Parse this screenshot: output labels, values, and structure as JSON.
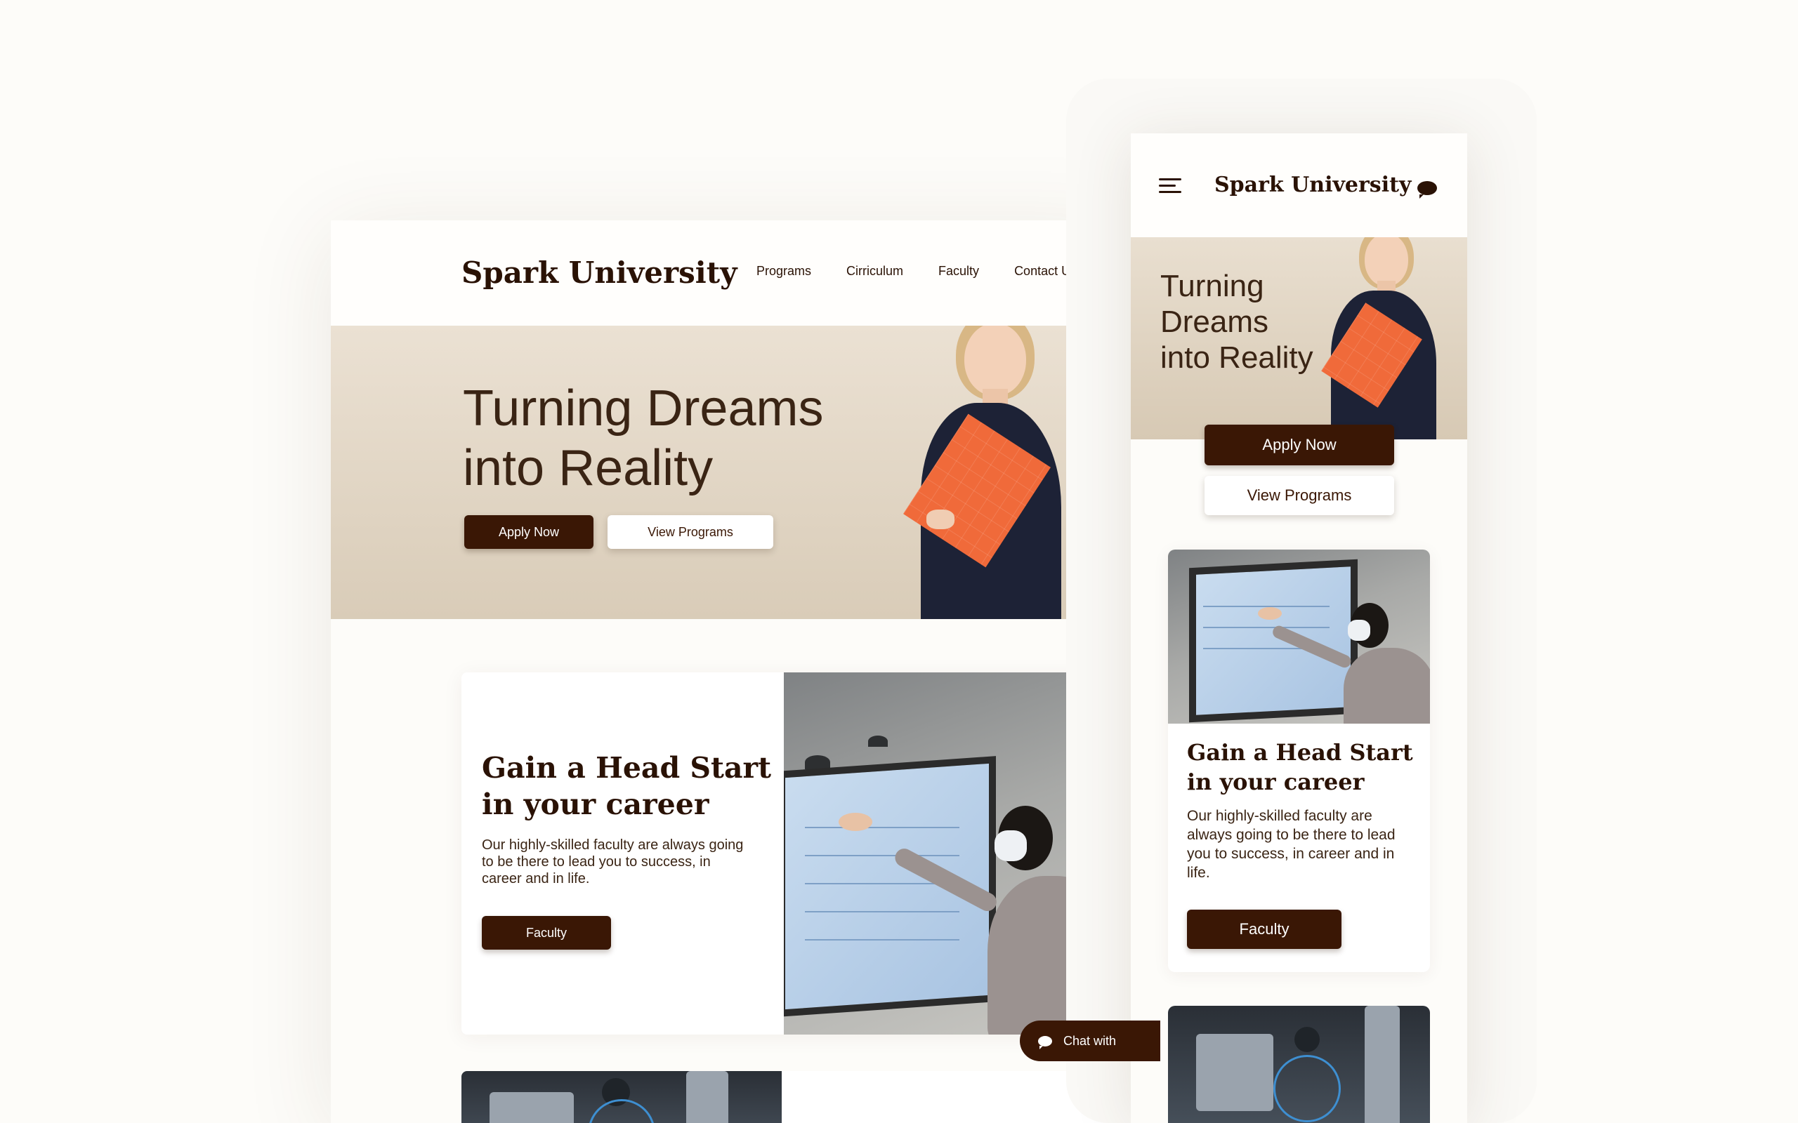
{
  "desktop": {
    "logo": "Spark University",
    "nav": [
      "Programs",
      "Cirriculum",
      "Faculty",
      "Contact Us"
    ],
    "hero": {
      "title_line1": "Turning Dreams",
      "title_line2": "into Reality",
      "apply_label": "Apply Now",
      "view_label": "View Programs"
    },
    "feature_card": {
      "title_line1": "Gain a Head Start",
      "title_line2": "in your career",
      "text": "Our highly-skilled faculty are always going to be there to lead you to success, in career and in life.",
      "button_label": "Faculty"
    },
    "chat_label": "Chat with"
  },
  "mobile": {
    "logo": "Spark University",
    "hero": {
      "title_line1": "Turning",
      "title_line2": "Dreams",
      "title_line3": "into Reality",
      "apply_label": "Apply Now",
      "view_label": "View Programs"
    },
    "feature_card": {
      "title_line1": "Gain a Head Start",
      "title_line2": "in your career",
      "text": "Our highly-skilled faculty are always going to be there to lead you to success, in career and in life.",
      "button_label": "Faculty"
    }
  },
  "icons": {
    "menu": "hamburger-menu-icon",
    "chat": "chat-bubble-icon"
  },
  "colors": {
    "brand_dark": "#3a1705",
    "hero_bg": "#e6dccd",
    "page_bg": "#fdfcf9",
    "accent_book": "#f06a3a"
  }
}
